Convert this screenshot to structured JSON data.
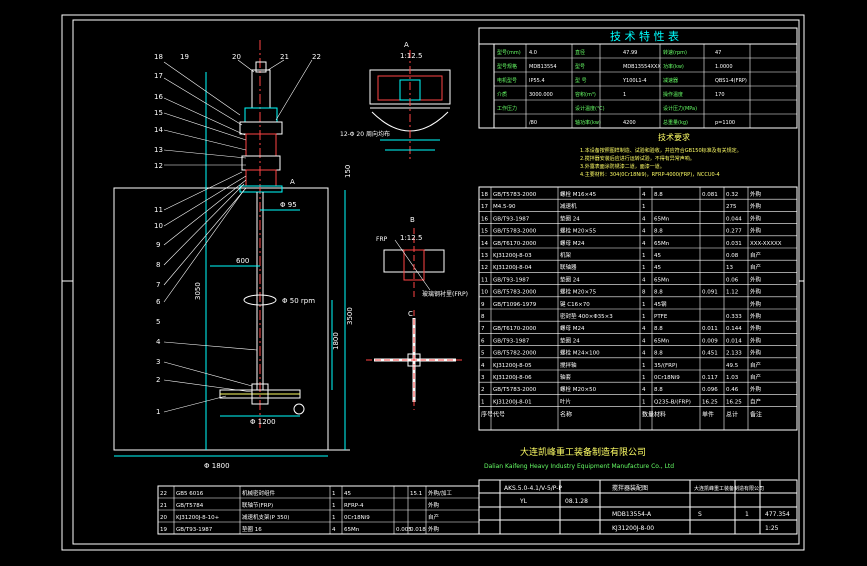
{
  "tech_table": {
    "title": "技 术 特 性 表",
    "rows": [
      [
        "型号(mm)",
        "4.0",
        "直径",
        "47.99",
        "转速(rpm)",
        "47"
      ],
      [
        "型号规格",
        "MDB13554",
        "型号",
        "MDB13554XXX",
        "功率(kw)",
        "1.0000"
      ],
      [
        "电机型号",
        "IP55.4",
        "型 号",
        "Y100L1-4",
        "减速器",
        "QBS1-4(FRP)"
      ],
      [
        "介质",
        "3000.000",
        "容积(m³)",
        "1",
        "操作温度",
        "170"
      ],
      [
        "工作压力",
        "",
        "设计温度(℃)",
        "",
        "设计压力(MPa)",
        ""
      ],
      [
        "",
        "/80",
        "轴功率(kw)",
        "4200",
        "总重量(kg)",
        "p=1100"
      ]
    ]
  },
  "tech_req_title": "技术要求",
  "tech_req": [
    "1.本设备按照图样制造、试验和验收，并应符合GB150标准及有关规定。",
    "2.搅拌器安装后应进行运转试验，不得有异常声响。",
    "3.外露表面涂防锈漆二道，面漆一道。",
    "4.主要材料：304(0Cr18Ni9)，RFRP-4000(FRP)，NCCU0-4"
  ],
  "parts_header": [
    "序号",
    "代号",
    "名称",
    "数量",
    "材料",
    "单件",
    "总计",
    "备注"
  ],
  "parts": [
    [
      "18",
      "GB/T5783-2000",
      "螺栓 M16×45",
      "4",
      "8.8",
      "0.081",
      "0.32",
      "外购"
    ],
    [
      "17",
      "M4.5-90",
      "减速机",
      "1",
      "",
      "",
      "275",
      "外购"
    ],
    [
      "16",
      "GB/T93-1987",
      "垫圈 24",
      "4",
      "65Mn",
      "",
      "0.044",
      "外购"
    ],
    [
      "15",
      "GB/T5783-2000",
      "螺栓 M20×55",
      "4",
      "8.8",
      "",
      "0.277",
      "外购"
    ],
    [
      "14",
      "GB/T6170-2000",
      "螺母 M24",
      "4",
      "65Mn",
      "",
      "0.031",
      "XXX-XXXXX"
    ],
    [
      "13",
      "KJ31200J-8-03",
      "机架",
      "1",
      "45",
      "",
      "0.08",
      "自产"
    ],
    [
      "12",
      "KJ31200J-8-04",
      "联轴器",
      "1",
      "45",
      "",
      "13",
      "自产"
    ],
    [
      "11",
      "GB/T93-1987",
      "垫圈 24",
      "4",
      "65Mn",
      "",
      "0.06",
      "外购"
    ],
    [
      "10",
      "GB/T5783-2000",
      "螺栓 M20×75",
      "8",
      "8.8",
      "0.091",
      "1.12",
      "外购"
    ],
    [
      "9",
      "GB/T1096-1979",
      "键 C16×70",
      "1",
      "45钢",
      "",
      "",
      "外购"
    ],
    [
      "8",
      "",
      "密封垫 400×Φ35×3",
      "1",
      "PTFE",
      "",
      "0.333",
      "外购"
    ],
    [
      "7",
      "GB/T6170-2000",
      "螺母 M24",
      "4",
      "8.8",
      "0.011",
      "0.144",
      "外购"
    ],
    [
      "6",
      "GB/T93-1987",
      "垫圈 24",
      "4",
      "65Mn",
      "0.009",
      "0.014",
      "外购"
    ],
    [
      "5",
      "GB/T5782-2000",
      "螺栓 M24×100",
      "4",
      "8.8",
      "0.451",
      "2.133",
      "外购"
    ],
    [
      "4",
      "KJ31200J-8-05",
      "搅拌轴",
      "1",
      "35/(FRP)",
      "",
      "49.5",
      "自产"
    ],
    [
      "3",
      "KJ31200J-8-06",
      "轴套",
      "1",
      "0Cr18Ni9",
      "0.117",
      "1.03",
      "自产"
    ],
    [
      "2",
      "GB/T5783-2000",
      "螺栓 M20×50",
      "4",
      "8.8",
      "0.096",
      "0.46",
      "外购"
    ],
    [
      "1",
      "KJ31200J-8-01",
      "叶片",
      "1",
      "Q235-B/(FRP)",
      "16.25",
      "16.25",
      "自产"
    ]
  ],
  "company_cn": "大连凯峰重工装备制造有限公司",
  "company_en": "Dalian Kaifeng Heavy Industry Equipment Manufacture Co., Ltd",
  "lower_parts": [
    [
      "22",
      "GB5 6016",
      "机械密封组件",
      "1",
      "45",
      "",
      "15.1",
      "外购/加工"
    ],
    [
      "21",
      "GB/T5784",
      "联轴节(FRP)",
      "1",
      "RFRP-4",
      "",
      "",
      "外购"
    ],
    [
      "20",
      "KJ31200J-8-10+",
      "减速机支架(P 350)",
      "1",
      "0Cr18Ni9",
      "",
      "",
      "自产"
    ],
    [
      "19",
      "GB/T93-1987",
      "垫圈 16",
      "4",
      "65Mn",
      "0.005",
      "0.018",
      "外购"
    ]
  ],
  "title_block": {
    "model": "AKS.5.0-4.1/V-5/P-P",
    "drawing_name": "搅拌器装配图",
    "drawing_no": "KJ31200J-8-00",
    "code": "MDB13554-A",
    "weight": "477.354",
    "scale": "1:25",
    "sheet": "1",
    "designer": "YL",
    "date": "08.1.28",
    "company_short": "大连凯峰重工装备制造有限公司",
    "stage": "S"
  },
  "dims": {
    "d1800": "Φ 1800",
    "d1200": "Φ 1200",
    "d600": "600",
    "d95": "Φ 95",
    "d50": "Φ 50 rpm",
    "h3500": "3500",
    "h3050": "3050",
    "h1800": "1800",
    "h150": "150",
    "note_a": "A",
    "view_a": "A",
    "view_a_scale": "1:12.5",
    "view_b": "B",
    "view_b_scale": "1:12.5",
    "section_label": "12-Φ 20\n周向均布",
    "frp_label": "FRP",
    "frp_note": "玻璃钢衬里(FRP)",
    "c_label": "C"
  },
  "callouts": [
    "18",
    "19",
    "20",
    "21",
    "22",
    "17",
    "16",
    "15",
    "14",
    "13",
    "12",
    "11",
    "10",
    "9",
    "8",
    "7",
    "6",
    "5",
    "4",
    "3",
    "2",
    "1"
  ]
}
